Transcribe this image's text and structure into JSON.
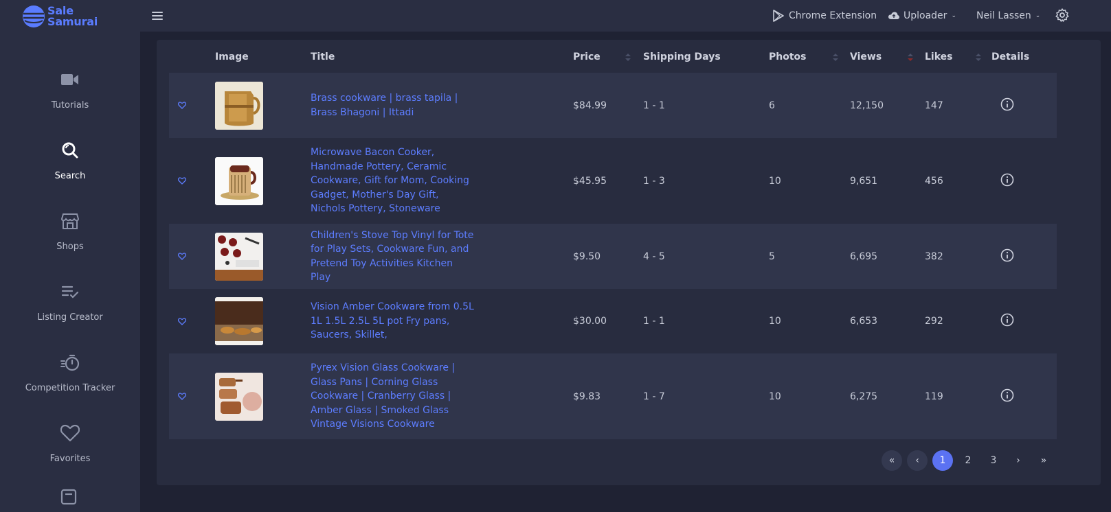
{
  "app": {
    "logo_line1": "Sale",
    "logo_line2": "Samurai",
    "brand_color": "#5a7cff"
  },
  "sidebar": {
    "items": [
      {
        "label": "Tutorials",
        "icon": "video-camera-icon"
      },
      {
        "label": "Search",
        "icon": "search-icon",
        "active": true
      },
      {
        "label": "Shops",
        "icon": "storefront-icon"
      },
      {
        "label": "Listing Creator",
        "icon": "list-check-icon"
      },
      {
        "label": "Competition Tracker",
        "icon": "stopwatch-icon"
      },
      {
        "label": "Favorites",
        "icon": "heart-icon"
      }
    ]
  },
  "header": {
    "chrome_extension": "Chrome Extension",
    "uploader": "Uploader",
    "user": "Neil Lassen"
  },
  "table": {
    "columns": {
      "image": "Image",
      "title": "Title",
      "price": "Price",
      "shipping": "Shipping Days",
      "photos": "Photos",
      "views": "Views",
      "likes": "Likes",
      "details": "Details"
    },
    "rows": [
      {
        "title": "Brass cookware | brass tapila | Brass Bhagoni | Ittadi",
        "price": "$84.99",
        "shipping": "1 - 1",
        "photos": "6",
        "views": "12,150",
        "likes": "147"
      },
      {
        "title": "Microwave Bacon Cooker, Handmade Pottery, Ceramic Cookware, Gift for Mom, Cooking Gadget, Mother's Day Gift, Nichols Pottery, Stoneware",
        "price": "$45.95",
        "shipping": "1 - 3",
        "photos": "10",
        "views": "9,651",
        "likes": "456"
      },
      {
        "title": "Children's Stove Top Vinyl for Tote for Play Sets, Cookware Fun, and Pretend Toy Activities Kitchen Play",
        "price": "$9.50",
        "shipping": "4 - 5",
        "photos": "5",
        "views": "6,695",
        "likes": "382"
      },
      {
        "title": "Vision Amber Cookware from 0.5L 1L 1.5L 2.5L 5L pot Fry pans, Saucers, Skillet,",
        "price": "$30.00",
        "shipping": "1 - 1",
        "photos": "10",
        "views": "6,653",
        "likes": "292"
      },
      {
        "title": "Pyrex Vision Glass Cookware | Glass Pans | Corning Glass Cookware | Cranberry Glass | Amber Glass | Smoked Glass Vintage Visions Cookware",
        "price": "$9.83",
        "shipping": "1 - 7",
        "photos": "10",
        "views": "6,275",
        "likes": "119"
      }
    ]
  },
  "pagination": {
    "first": "«",
    "prev": "‹",
    "pages": [
      "1",
      "2",
      "3"
    ],
    "current": "1",
    "next": "›",
    "last": "»"
  }
}
